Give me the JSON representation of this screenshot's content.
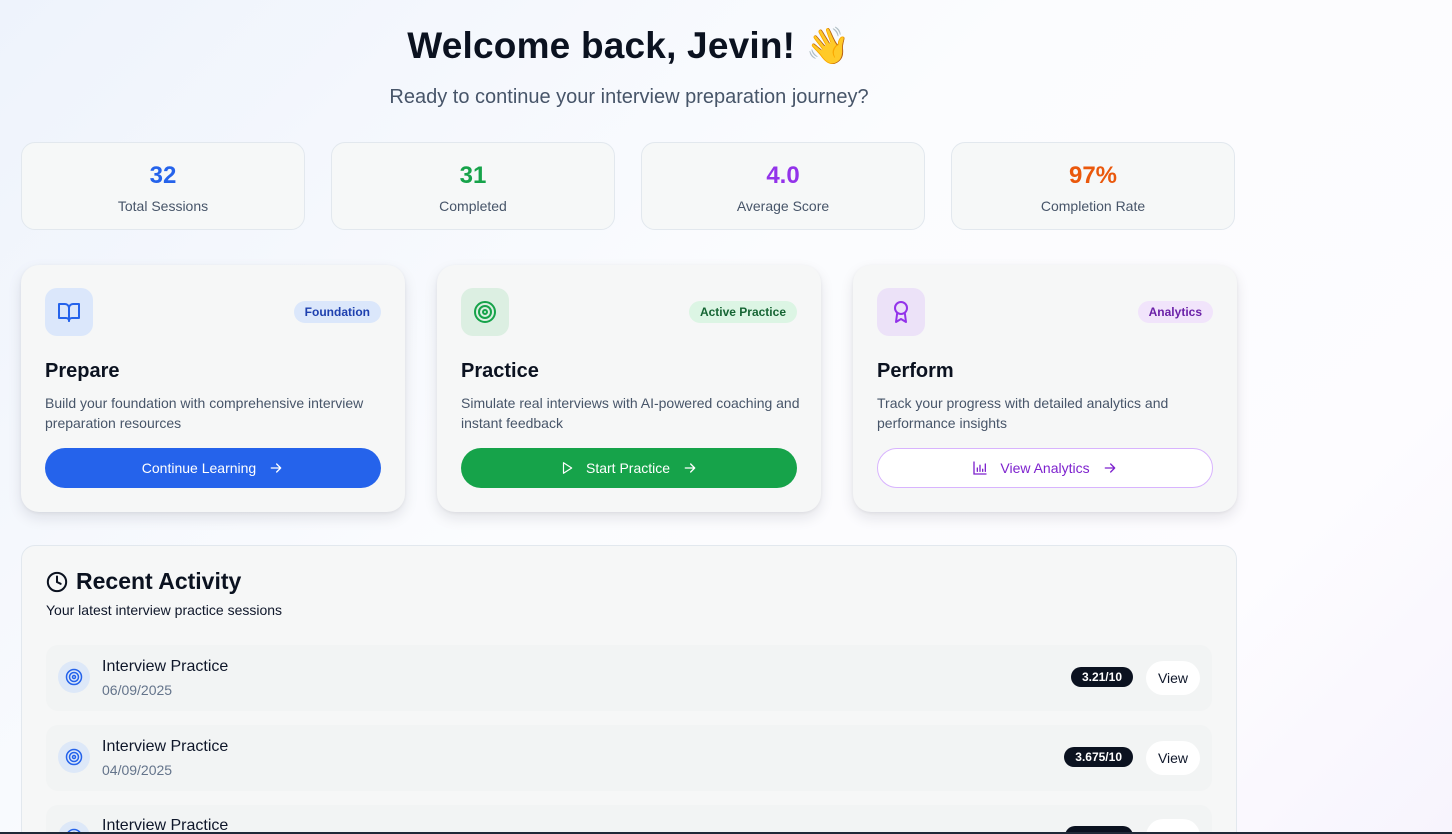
{
  "header": {
    "title": "Welcome back, Jevin!",
    "wave_emoji": "👋",
    "subtitle": "Ready to continue your interview preparation journey?"
  },
  "stats": [
    {
      "value": "32",
      "label": "Total Sessions",
      "color": "#2563eb"
    },
    {
      "value": "31",
      "label": "Completed",
      "color": "#16a34a"
    },
    {
      "value": "4.0",
      "label": "Average Score",
      "color": "#9333ea"
    },
    {
      "value": "97%",
      "label": "Completion Rate",
      "color": "#ea580c"
    }
  ],
  "cards": [
    {
      "icon": "book-open-icon",
      "badge": "Foundation",
      "title": "Prepare",
      "description": "Build your foundation with comprehensive interview preparation resources",
      "button_label": "Continue Learning",
      "accent": "#2563eb"
    },
    {
      "icon": "target-icon",
      "badge": "Active Practice",
      "title": "Practice",
      "description": "Simulate real interviews with AI-powered coaching and instant feedback",
      "button_label": "Start Practice",
      "accent": "#16a34a"
    },
    {
      "icon": "award-icon",
      "badge": "Analytics",
      "title": "Perform",
      "description": "Track your progress with detailed analytics and performance insights",
      "button_label": "View Analytics",
      "accent": "#9333ea"
    }
  ],
  "activity": {
    "title": "Recent Activity",
    "subtitle": "Your latest interview practice sessions",
    "items": [
      {
        "title": "Interview Practice",
        "date": "06/09/2025",
        "score": "3.21/10",
        "action": "View"
      },
      {
        "title": "Interview Practice",
        "date": "04/09/2025",
        "score": "3.675/10",
        "action": "View"
      },
      {
        "title": "Interview Practice",
        "date": "",
        "score": "",
        "action": ""
      }
    ]
  }
}
